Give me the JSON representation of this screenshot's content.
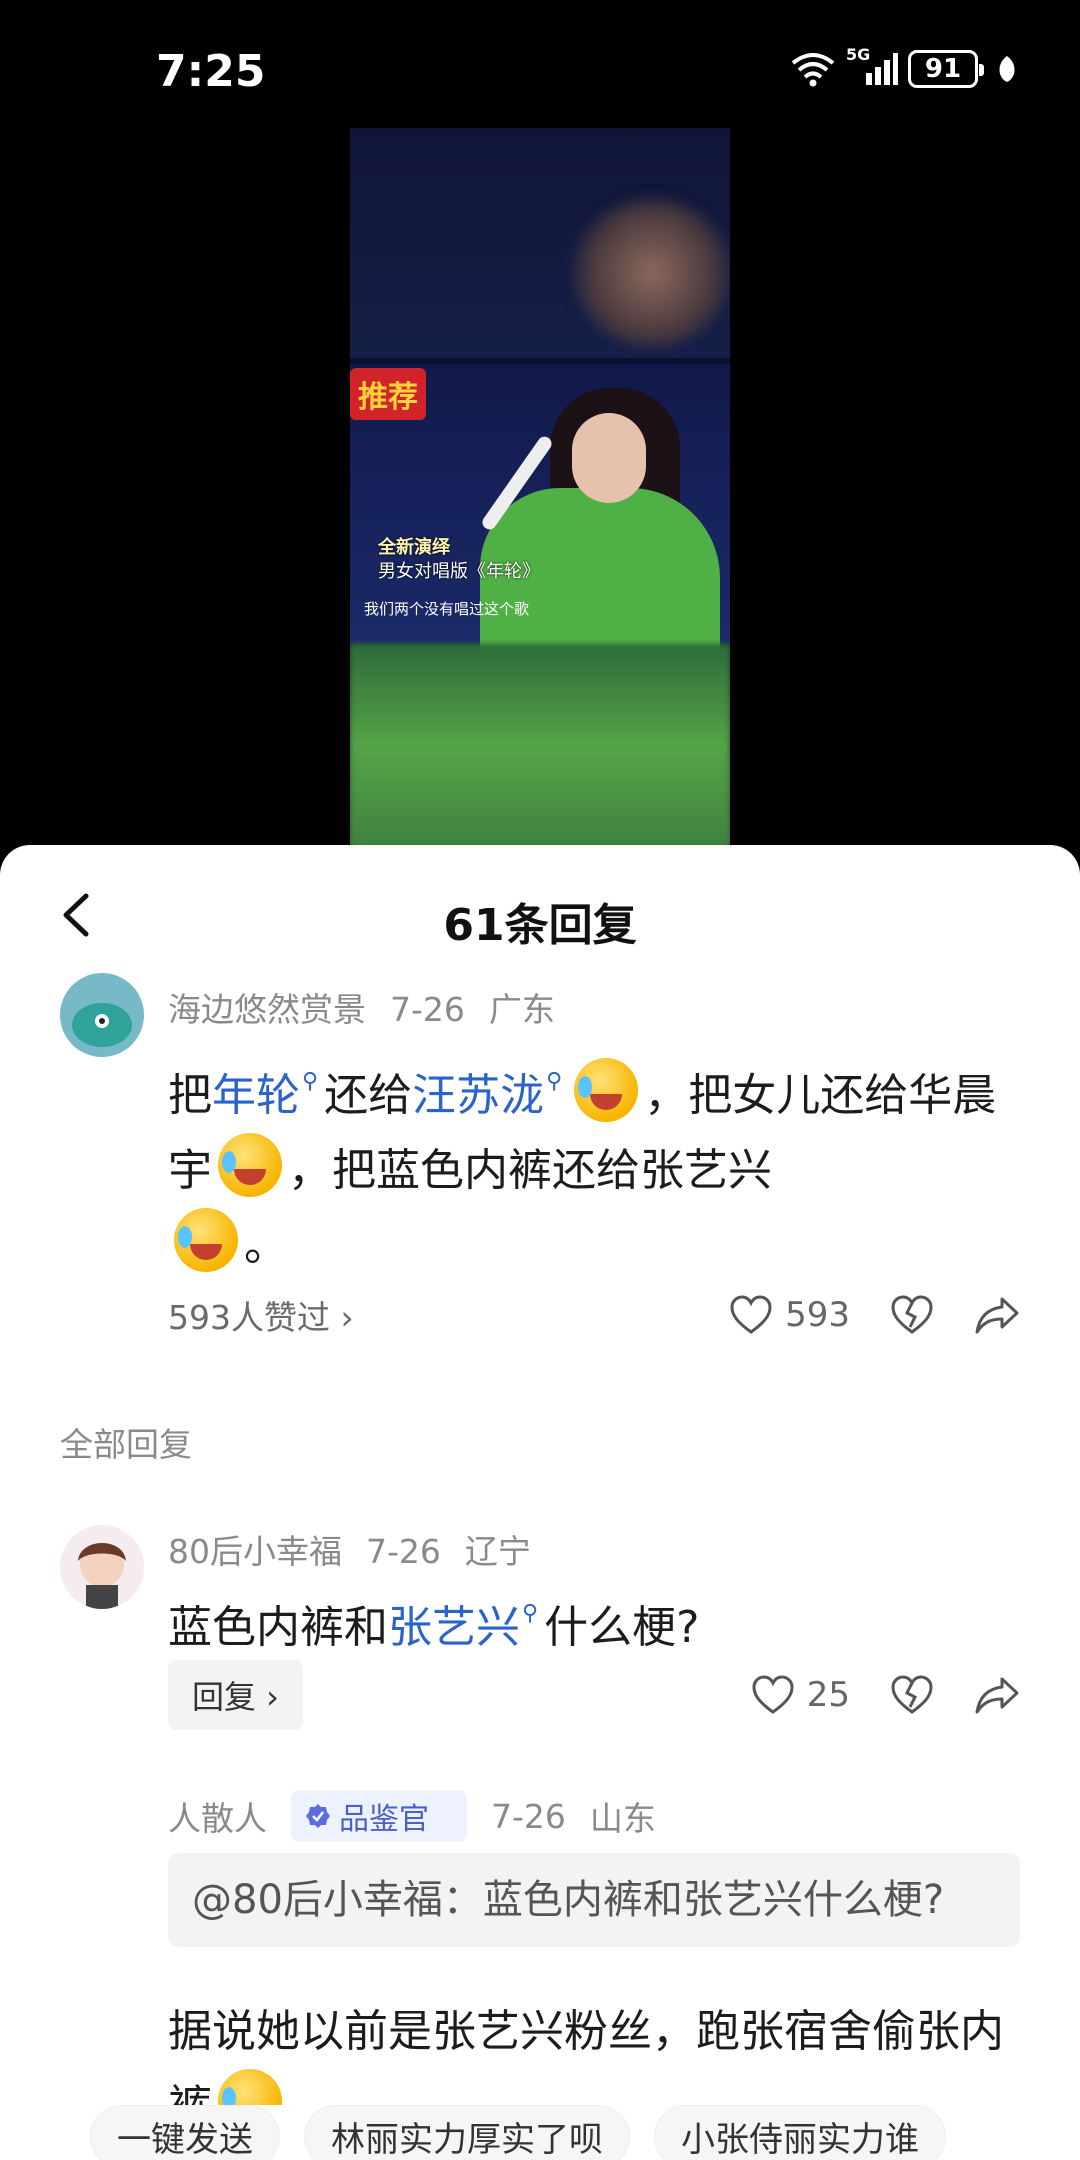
{
  "status_bar": {
    "time": "7:25",
    "network": "5G",
    "battery": "91"
  },
  "video": {
    "logo_text": "推荐",
    "overlay_line_1": "全新演绎",
    "overlay_line_2": "男女对唱版《年轮》",
    "subtitle": "我们两个没有唱过这个歌"
  },
  "sheet": {
    "title": "61条回复"
  },
  "main_comment": {
    "user": "海边悠然赏景",
    "date": "7-26",
    "location": "广东",
    "text_1": "把",
    "link_1": "年轮",
    "text_2": "还给",
    "link_2": "汪苏泷",
    "text_3": "，把女儿还给华晨宇",
    "text_4": "，把蓝色内裤还给张艺兴",
    "text_5": "。",
    "likers": "593人赞过 ›",
    "like_count": "593"
  },
  "section_label": "全部回复",
  "reply_1": {
    "user": "80后小幸福",
    "date": "7-26",
    "location": "辽宁",
    "text_1": "蓝色内裤和",
    "link_1": "张艺兴",
    "text_2": "什么梗?",
    "reply_label": "回复 ›",
    "like_count": "25"
  },
  "reply_2": {
    "user": "人散人",
    "badge": "品鉴官",
    "date": "7-26",
    "location": "山东",
    "quote": "@80后小幸福：蓝色内裤和张艺兴什么梗?",
    "text": "据说她以前是张艺兴粉丝，跑张宿舍偷张内裤"
  },
  "bottom_bar": {
    "chips": [
      "一键发送",
      "林丽实力厚实了呗",
      "小张侍丽实力谁"
    ]
  }
}
